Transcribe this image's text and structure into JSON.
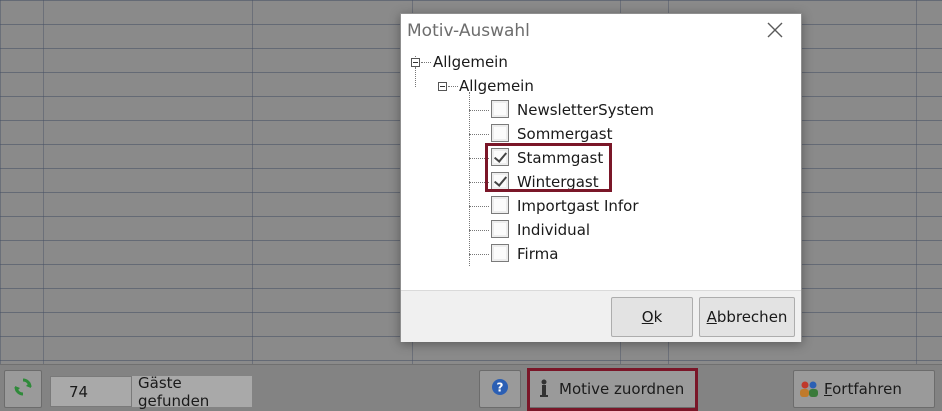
{
  "dialog": {
    "title": "Motiv-Auswahl",
    "tree": {
      "root_label": "Allgemein",
      "group_label": "Allgemein",
      "items": [
        {
          "label": "NewsletterSystem",
          "checked": false
        },
        {
          "label": "Sommergast",
          "checked": false
        },
        {
          "label": "Stammgast",
          "checked": true
        },
        {
          "label": "Wintergast",
          "checked": true
        },
        {
          "label": "Importgast Infor",
          "checked": false
        },
        {
          "label": "Individual",
          "checked": false
        },
        {
          "label": "Firma",
          "checked": false
        }
      ]
    },
    "ok_mnemonic": "O",
    "ok_rest": "k",
    "cancel_mnemonic": "A",
    "cancel_rest": "bbrechen"
  },
  "toolbar": {
    "guest_count": "74",
    "guest_count_label": "Gäste gefunden",
    "assign_label": "Motive zuordnen",
    "continue_mnemonic": "F",
    "continue_rest": "ortfahren"
  },
  "colors": {
    "highlight": "#7a1628",
    "help_icon": "#2b5fb4",
    "refresh_icon": "#2f8a3a"
  },
  "icons": {
    "close": "close-icon",
    "refresh": "refresh-icon",
    "help": "help-icon",
    "assign": "person-tag-icon",
    "continue": "users-icon"
  }
}
